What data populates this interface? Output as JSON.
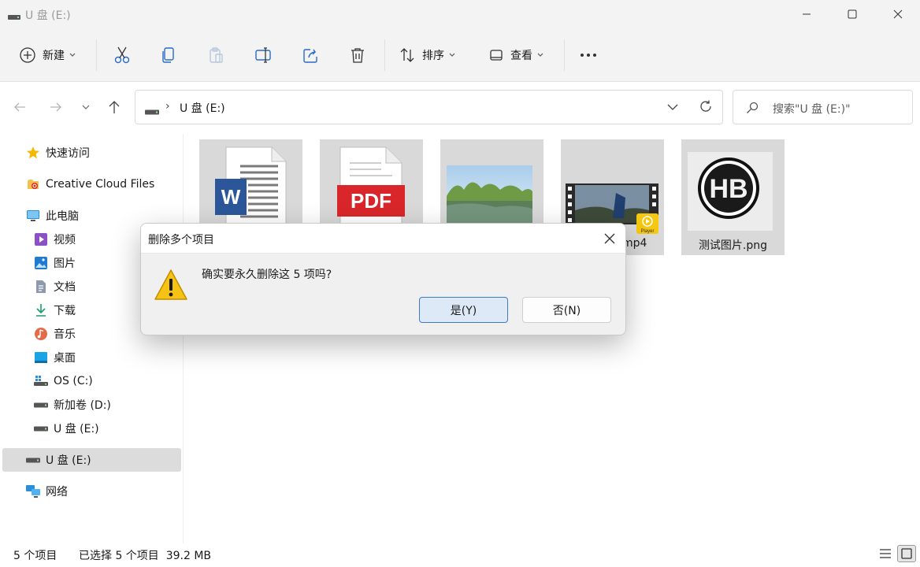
{
  "window": {
    "title": "U 盘 (E:)",
    "controls": {
      "minimize": "minimize",
      "maximize": "maximize",
      "close": "close"
    }
  },
  "toolbar": {
    "new_label": "新建",
    "sort_label": "排序",
    "view_label": "查看",
    "icons": [
      "cut-icon",
      "copy-icon",
      "paste-icon",
      "rename-icon",
      "share-icon",
      "delete-icon",
      "more-icon"
    ]
  },
  "address": {
    "path": "U 盘 (E:)",
    "separator": "›"
  },
  "search": {
    "placeholder": "搜索\"U 盘 (E:)\""
  },
  "sidebar": {
    "quick_access": "快速访问",
    "creative_cloud": "Creative Cloud Files",
    "this_pc": "此电脑",
    "videos": "视频",
    "pictures": "图片",
    "documents": "文档",
    "downloads": "下载",
    "music": "音乐",
    "desktop": "桌面",
    "drive_c": "OS (C:)",
    "drive_d": "新加卷 (D:)",
    "drive_e": "U 盘 (E:)",
    "drive_e_selected": "U 盘 (E:)",
    "network": "网络"
  },
  "files": [
    {
      "name": "",
      "type": "word-document"
    },
    {
      "name": "",
      "type": "pdf-document"
    },
    {
      "name": "",
      "type": "landscape-image"
    },
    {
      "name": "mp4",
      "type": "video"
    },
    {
      "name": "测试图片.png",
      "type": "hb-image"
    }
  ],
  "status": {
    "count": "5 个项目",
    "selection": "已选择 5 个项目  39.2 MB"
  },
  "dialog": {
    "title": "删除多个项目",
    "message": "确实要永久删除这 5 项吗?",
    "yes_label": "是(Y)",
    "no_label": "否(N)"
  },
  "colors": {
    "accent": "#3d7bd0",
    "tile_selected": "#d9d9d9",
    "pdf_red": "#d9262a",
    "word_blue": "#2b579a",
    "warning_yellow": "#f6c315"
  }
}
